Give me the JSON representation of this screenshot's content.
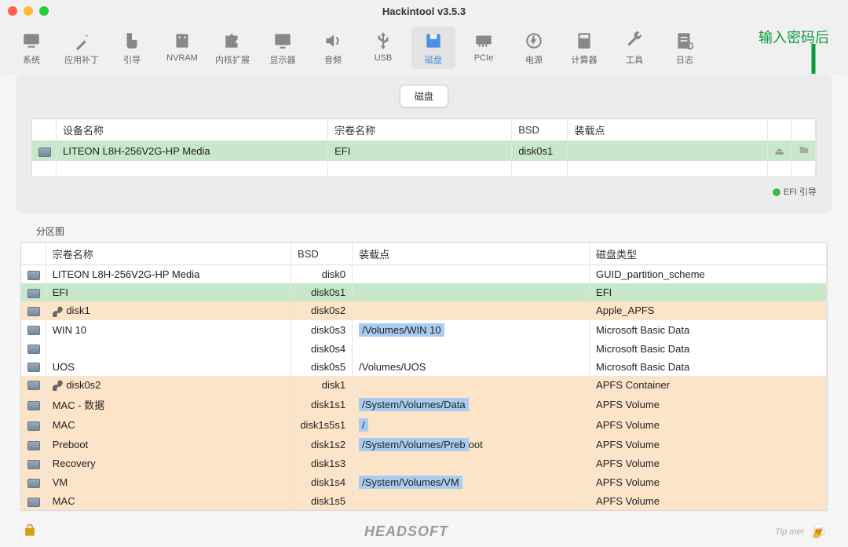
{
  "title": "Hackintool v3.5.3",
  "annotation": "输入密码后",
  "toolbar": [
    {
      "label": "系统",
      "icon": "monitor"
    },
    {
      "label": "应用补丁",
      "icon": "wand"
    },
    {
      "label": "引导",
      "icon": "boot"
    },
    {
      "label": "NVRAM",
      "icon": "memory"
    },
    {
      "label": "内核扩展",
      "icon": "puzzle"
    },
    {
      "label": "显示器",
      "icon": "display"
    },
    {
      "label": "音频",
      "icon": "speaker"
    },
    {
      "label": "USB",
      "icon": "usb"
    },
    {
      "label": "磁盘",
      "icon": "disk",
      "active": true
    },
    {
      "label": "PCIe",
      "icon": "pcie"
    },
    {
      "label": "电源",
      "icon": "power"
    },
    {
      "label": "计算器",
      "icon": "calc"
    },
    {
      "label": "工具",
      "icon": "wrench"
    },
    {
      "label": "日志",
      "icon": "log"
    }
  ],
  "tab_center": "磁盘",
  "efi_table": {
    "headers": [
      "",
      "设备名称",
      "宗卷名称",
      "BSD",
      "装载点",
      "",
      ""
    ],
    "rows": [
      {
        "device": "LITEON L8H-256V2G-HP Media",
        "volume": "EFI",
        "bsd": "disk0s1",
        "mount": "",
        "cls": "row-green",
        "action": true
      }
    ],
    "legend": "EFI 引导"
  },
  "partition": {
    "title": "分区图",
    "headers": [
      "",
      "宗卷名称",
      "BSD",
      "装载点",
      "磁盘类型"
    ],
    "rows": [
      {
        "name": "LITEON L8H-256V2G-HP Media",
        "bsd": "disk0",
        "mount": "",
        "type": "GUID_partition_scheme",
        "cls": ""
      },
      {
        "name": "EFI",
        "bsd": "disk0s1",
        "mount": "",
        "type": "EFI",
        "cls": "row-green"
      },
      {
        "name": "disk1",
        "bsd": "disk0s2",
        "mount": "",
        "type": "Apple_APFS",
        "cls": "row-peach",
        "link": true
      },
      {
        "name": "WIN 10",
        "bsd": "disk0s3",
        "mount": "/Volumes/WIN 10",
        "type": "Microsoft Basic Data",
        "cls": "",
        "mount_hl": true
      },
      {
        "name": "",
        "bsd": "disk0s4",
        "mount": "",
        "type": "Microsoft Basic Data",
        "cls": ""
      },
      {
        "name": "UOS",
        "bsd": "disk0s5",
        "mount": "/Volumes/UOS",
        "type": "Microsoft Basic Data",
        "cls": ""
      },
      {
        "name": "disk0s2",
        "bsd": "disk1",
        "mount": "",
        "type": "APFS Container",
        "cls": "row-peach",
        "link": true
      },
      {
        "name": "MAC - 数据",
        "bsd": "disk1s1",
        "mount": "/System/Volumes/Data",
        "type": "APFS Volume",
        "cls": "row-peach",
        "mount_hl": true
      },
      {
        "name": "MAC",
        "bsd": "disk1s5s1",
        "mount": "/",
        "type": "APFS Volume",
        "cls": "row-peach",
        "mount_hl": true
      },
      {
        "name": "Preboot",
        "bsd": "disk1s2",
        "mount": "/System/Volumes/Preboot",
        "type": "APFS Volume",
        "cls": "row-peach",
        "mount_hl_partial": "/System/Volumes/Preb"
      },
      {
        "name": "Recovery",
        "bsd": "disk1s3",
        "mount": "",
        "type": "APFS Volume",
        "cls": "row-peach"
      },
      {
        "name": "VM",
        "bsd": "disk1s4",
        "mount": "/System/Volumes/VM",
        "type": "APFS Volume",
        "cls": "row-peach",
        "mount_hl": true
      },
      {
        "name": "MAC",
        "bsd": "disk1s5",
        "mount": "",
        "type": "APFS Volume",
        "cls": "row-peach"
      }
    ]
  },
  "footer": {
    "brand": "HEADSOFT",
    "tip": "Tip me!"
  }
}
